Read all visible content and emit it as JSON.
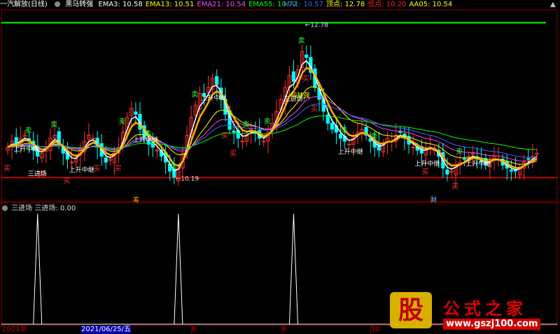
{
  "header": {
    "title": "一汽解放(日线)",
    "indicator_name": "黑马转强",
    "ema": [
      {
        "label": "EMA3:",
        "value": "10.58",
        "color": "#ffffff"
      },
      {
        "label": "EMA13:",
        "value": "10.51",
        "color": "#ffff00"
      },
      {
        "label": "EMA21:",
        "value": "10.54",
        "color": "#ff44ff"
      },
      {
        "label": "EMA55:",
        "value": "10.72",
        "color": "#00ff00"
      }
    ],
    "right": [
      {
        "label": "MA1:",
        "value": "10.57",
        "color": "#4466ff"
      },
      {
        "label": "顶点:",
        "value": "12.78",
        "color": "#ffff00"
      },
      {
        "label": "低点:",
        "value": "10.20",
        "color": "#ff2020"
      },
      {
        "label": "AA05:",
        "value": "10.54",
        "color": "#ffff00"
      }
    ]
  },
  "subpanel": {
    "title": "三进场",
    "value_label": "三进场:",
    "value": "0.00"
  },
  "xaxis": {
    "labels": [
      "2021年",
      "2021/06/25/五",
      "8",
      "9",
      "10"
    ]
  },
  "price_labels": {
    "high": "12.78",
    "low": "10.19"
  },
  "markers": {
    "sell": "卖",
    "buy": "买",
    "up_relay": "上升中继",
    "three_entry": "三进场",
    "three_entry_excl": "三进场!",
    "ant_strong": "蚂转强",
    "bottom_mark_1": "筹",
    "bottom_mark_2": "财"
  },
  "watermark": {
    "logo_char": "股",
    "name": "公式之家",
    "url": "www.gszj100.com"
  },
  "colors": {
    "up": "#ff3030",
    "down": "#00ffff",
    "ema3": "#ffffff",
    "ema13": "#ffff00",
    "ema21": "#ff44ff",
    "ema55": "#00ff00",
    "aa05": "#ffb000",
    "ma1": "#4466ff",
    "top_line": "#00ff00",
    "bottom_line": "#ff0000"
  },
  "chart_data": {
    "type": "candlestick",
    "top_level": 12.78,
    "bottom_level": 10.19,
    "close": [
      10.7,
      10.8,
      10.75,
      10.85,
      10.9,
      10.8,
      10.65,
      10.55,
      10.6,
      10.7,
      10.85,
      10.9,
      10.75,
      10.6,
      10.5,
      10.45,
      10.5,
      10.65,
      10.8,
      10.9,
      10.85,
      10.7,
      10.55,
      10.45,
      10.5,
      10.6,
      10.7,
      10.95,
      11.2,
      11.35,
      11.25,
      11.0,
      10.85,
      10.75,
      10.7,
      10.65,
      10.55,
      10.45,
      10.3,
      10.2,
      10.35,
      10.6,
      10.9,
      11.2,
      11.4,
      11.6,
      11.55,
      11.7,
      11.85,
      11.75,
      11.5,
      11.25,
      11.0,
      10.95,
      10.85,
      10.8,
      10.9,
      11.0,
      10.95,
      10.85,
      10.8,
      10.95,
      11.1,
      11.3,
      11.5,
      11.7,
      11.9,
      11.8,
      12.0,
      12.3,
      12.2,
      11.95,
      11.7,
      11.5,
      11.3,
      11.1,
      11.0,
      10.95,
      10.85,
      10.8,
      10.75,
      10.85,
      10.95,
      11.0,
      10.9,
      10.8,
      10.7,
      10.65,
      10.75,
      10.85,
      10.8,
      10.9,
      10.95,
      10.85,
      10.75,
      10.7,
      10.65,
      10.6,
      10.65,
      10.7,
      10.65,
      10.55,
      10.35,
      10.25,
      10.3,
      10.4,
      10.45,
      10.5,
      10.55,
      10.6,
      10.5,
      10.45,
      10.4,
      10.45,
      10.55,
      10.5,
      10.4,
      10.35,
      10.3,
      10.3,
      10.35,
      10.45,
      10.5,
      10.55,
      10.6
    ],
    "sub_spikes": [
      {
        "index": 7,
        "value": 1
      },
      {
        "index": 40,
        "value": 1
      },
      {
        "index": 67,
        "value": 1
      }
    ]
  }
}
